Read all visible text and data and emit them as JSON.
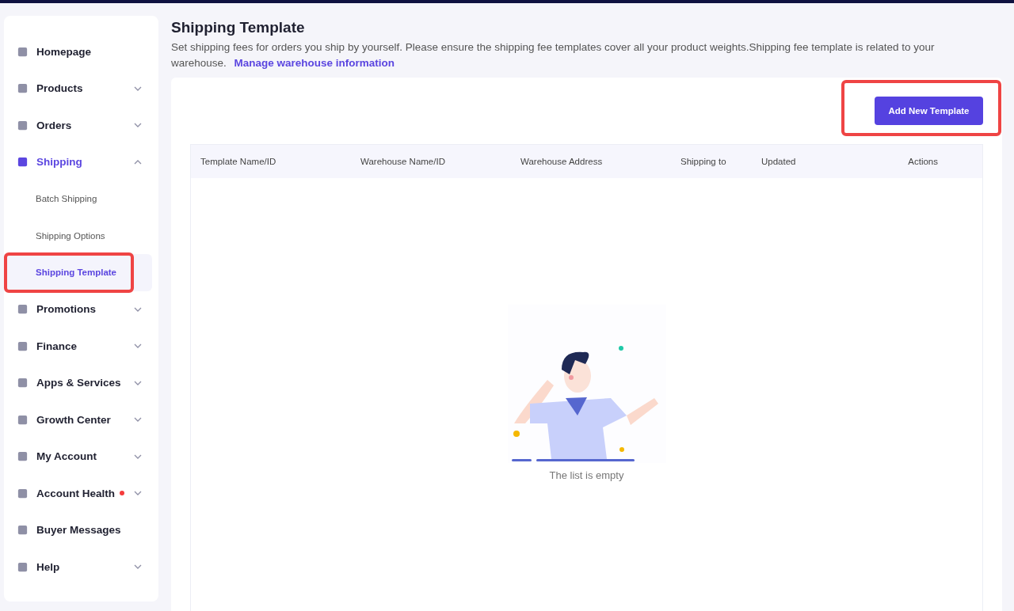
{
  "sidebar": {
    "items": [
      {
        "label": "Homepage",
        "kind": "link",
        "selected": false
      },
      {
        "label": "Products",
        "kind": "group",
        "expanded": false,
        "selected": false
      },
      {
        "label": "Orders",
        "kind": "group",
        "expanded": false,
        "selected": false
      },
      {
        "label": "Shipping",
        "kind": "group",
        "expanded": true,
        "selected": true,
        "children": [
          {
            "label": "Batch Shipping",
            "selected": false,
            "highlighted": false
          },
          {
            "label": "Shipping Options",
            "selected": false,
            "highlighted": false
          },
          {
            "label": "Shipping Template",
            "selected": true,
            "highlighted": true
          }
        ]
      },
      {
        "label": "Promotions",
        "kind": "group",
        "expanded": false,
        "selected": false
      },
      {
        "label": "Finance",
        "kind": "group",
        "expanded": false,
        "selected": false
      },
      {
        "label": "Apps & Services",
        "kind": "group",
        "expanded": false,
        "selected": false
      },
      {
        "label": "Growth Center",
        "kind": "group",
        "expanded": false,
        "selected": false
      },
      {
        "label": "My Account",
        "kind": "group",
        "expanded": false,
        "selected": false
      },
      {
        "label": "Account Health",
        "kind": "group",
        "expanded": false,
        "selected": false,
        "alert": true
      },
      {
        "label": "Buyer Messages",
        "kind": "link",
        "selected": false
      },
      {
        "label": "Help",
        "kind": "group",
        "expanded": false,
        "selected": false
      }
    ]
  },
  "page": {
    "title": "Shipping Template",
    "description": "Set shipping fees for orders you ship by yourself. Please ensure the shipping fee templates cover all your product weights.Shipping fee template is related to your warehouse.",
    "link": "Manage warehouse information"
  },
  "add_button": {
    "label": "Add New Template",
    "highlighted": true
  },
  "table": {
    "columns": [
      "Template Name/ID",
      "Warehouse Name/ID",
      "Warehouse Address",
      "Shipping to",
      "Updated",
      "Actions"
    ],
    "empty_text": "The list is empty"
  }
}
